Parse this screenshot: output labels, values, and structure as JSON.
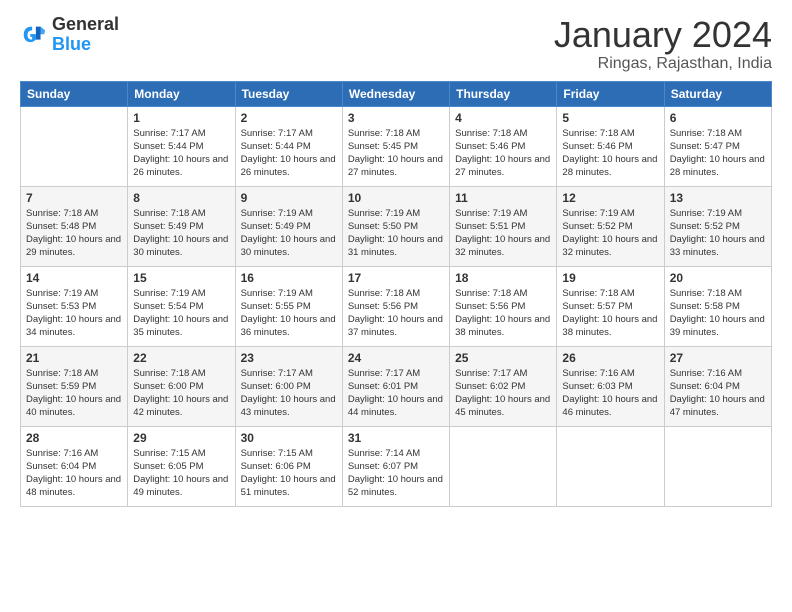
{
  "logo": {
    "general": "General",
    "blue": "Blue"
  },
  "title": "January 2024",
  "location": "Ringas, Rajasthan, India",
  "days_of_week": [
    "Sunday",
    "Monday",
    "Tuesday",
    "Wednesday",
    "Thursday",
    "Friday",
    "Saturday"
  ],
  "weeks": [
    [
      {
        "day": "",
        "sunrise": "",
        "sunset": "",
        "daylight": ""
      },
      {
        "day": "1",
        "sunrise": "Sunrise: 7:17 AM",
        "sunset": "Sunset: 5:44 PM",
        "daylight": "Daylight: 10 hours and 26 minutes."
      },
      {
        "day": "2",
        "sunrise": "Sunrise: 7:17 AM",
        "sunset": "Sunset: 5:44 PM",
        "daylight": "Daylight: 10 hours and 26 minutes."
      },
      {
        "day": "3",
        "sunrise": "Sunrise: 7:18 AM",
        "sunset": "Sunset: 5:45 PM",
        "daylight": "Daylight: 10 hours and 27 minutes."
      },
      {
        "day": "4",
        "sunrise": "Sunrise: 7:18 AM",
        "sunset": "Sunset: 5:46 PM",
        "daylight": "Daylight: 10 hours and 27 minutes."
      },
      {
        "day": "5",
        "sunrise": "Sunrise: 7:18 AM",
        "sunset": "Sunset: 5:46 PM",
        "daylight": "Daylight: 10 hours and 28 minutes."
      },
      {
        "day": "6",
        "sunrise": "Sunrise: 7:18 AM",
        "sunset": "Sunset: 5:47 PM",
        "daylight": "Daylight: 10 hours and 28 minutes."
      }
    ],
    [
      {
        "day": "7",
        "sunrise": "Sunrise: 7:18 AM",
        "sunset": "Sunset: 5:48 PM",
        "daylight": "Daylight: 10 hours and 29 minutes."
      },
      {
        "day": "8",
        "sunrise": "Sunrise: 7:18 AM",
        "sunset": "Sunset: 5:49 PM",
        "daylight": "Daylight: 10 hours and 30 minutes."
      },
      {
        "day": "9",
        "sunrise": "Sunrise: 7:19 AM",
        "sunset": "Sunset: 5:49 PM",
        "daylight": "Daylight: 10 hours and 30 minutes."
      },
      {
        "day": "10",
        "sunrise": "Sunrise: 7:19 AM",
        "sunset": "Sunset: 5:50 PM",
        "daylight": "Daylight: 10 hours and 31 minutes."
      },
      {
        "day": "11",
        "sunrise": "Sunrise: 7:19 AM",
        "sunset": "Sunset: 5:51 PM",
        "daylight": "Daylight: 10 hours and 32 minutes."
      },
      {
        "day": "12",
        "sunrise": "Sunrise: 7:19 AM",
        "sunset": "Sunset: 5:52 PM",
        "daylight": "Daylight: 10 hours and 32 minutes."
      },
      {
        "day": "13",
        "sunrise": "Sunrise: 7:19 AM",
        "sunset": "Sunset: 5:52 PM",
        "daylight": "Daylight: 10 hours and 33 minutes."
      }
    ],
    [
      {
        "day": "14",
        "sunrise": "Sunrise: 7:19 AM",
        "sunset": "Sunset: 5:53 PM",
        "daylight": "Daylight: 10 hours and 34 minutes."
      },
      {
        "day": "15",
        "sunrise": "Sunrise: 7:19 AM",
        "sunset": "Sunset: 5:54 PM",
        "daylight": "Daylight: 10 hours and 35 minutes."
      },
      {
        "day": "16",
        "sunrise": "Sunrise: 7:19 AM",
        "sunset": "Sunset: 5:55 PM",
        "daylight": "Daylight: 10 hours and 36 minutes."
      },
      {
        "day": "17",
        "sunrise": "Sunrise: 7:18 AM",
        "sunset": "Sunset: 5:56 PM",
        "daylight": "Daylight: 10 hours and 37 minutes."
      },
      {
        "day": "18",
        "sunrise": "Sunrise: 7:18 AM",
        "sunset": "Sunset: 5:56 PM",
        "daylight": "Daylight: 10 hours and 38 minutes."
      },
      {
        "day": "19",
        "sunrise": "Sunrise: 7:18 AM",
        "sunset": "Sunset: 5:57 PM",
        "daylight": "Daylight: 10 hours and 38 minutes."
      },
      {
        "day": "20",
        "sunrise": "Sunrise: 7:18 AM",
        "sunset": "Sunset: 5:58 PM",
        "daylight": "Daylight: 10 hours and 39 minutes."
      }
    ],
    [
      {
        "day": "21",
        "sunrise": "Sunrise: 7:18 AM",
        "sunset": "Sunset: 5:59 PM",
        "daylight": "Daylight: 10 hours and 40 minutes."
      },
      {
        "day": "22",
        "sunrise": "Sunrise: 7:18 AM",
        "sunset": "Sunset: 6:00 PM",
        "daylight": "Daylight: 10 hours and 42 minutes."
      },
      {
        "day": "23",
        "sunrise": "Sunrise: 7:17 AM",
        "sunset": "Sunset: 6:00 PM",
        "daylight": "Daylight: 10 hours and 43 minutes."
      },
      {
        "day": "24",
        "sunrise": "Sunrise: 7:17 AM",
        "sunset": "Sunset: 6:01 PM",
        "daylight": "Daylight: 10 hours and 44 minutes."
      },
      {
        "day": "25",
        "sunrise": "Sunrise: 7:17 AM",
        "sunset": "Sunset: 6:02 PM",
        "daylight": "Daylight: 10 hours and 45 minutes."
      },
      {
        "day": "26",
        "sunrise": "Sunrise: 7:16 AM",
        "sunset": "Sunset: 6:03 PM",
        "daylight": "Daylight: 10 hours and 46 minutes."
      },
      {
        "day": "27",
        "sunrise": "Sunrise: 7:16 AM",
        "sunset": "Sunset: 6:04 PM",
        "daylight": "Daylight: 10 hours and 47 minutes."
      }
    ],
    [
      {
        "day": "28",
        "sunrise": "Sunrise: 7:16 AM",
        "sunset": "Sunset: 6:04 PM",
        "daylight": "Daylight: 10 hours and 48 minutes."
      },
      {
        "day": "29",
        "sunrise": "Sunrise: 7:15 AM",
        "sunset": "Sunset: 6:05 PM",
        "daylight": "Daylight: 10 hours and 49 minutes."
      },
      {
        "day": "30",
        "sunrise": "Sunrise: 7:15 AM",
        "sunset": "Sunset: 6:06 PM",
        "daylight": "Daylight: 10 hours and 51 minutes."
      },
      {
        "day": "31",
        "sunrise": "Sunrise: 7:14 AM",
        "sunset": "Sunset: 6:07 PM",
        "daylight": "Daylight: 10 hours and 52 minutes."
      },
      {
        "day": "",
        "sunrise": "",
        "sunset": "",
        "daylight": ""
      },
      {
        "day": "",
        "sunrise": "",
        "sunset": "",
        "daylight": ""
      },
      {
        "day": "",
        "sunrise": "",
        "sunset": "",
        "daylight": ""
      }
    ]
  ]
}
